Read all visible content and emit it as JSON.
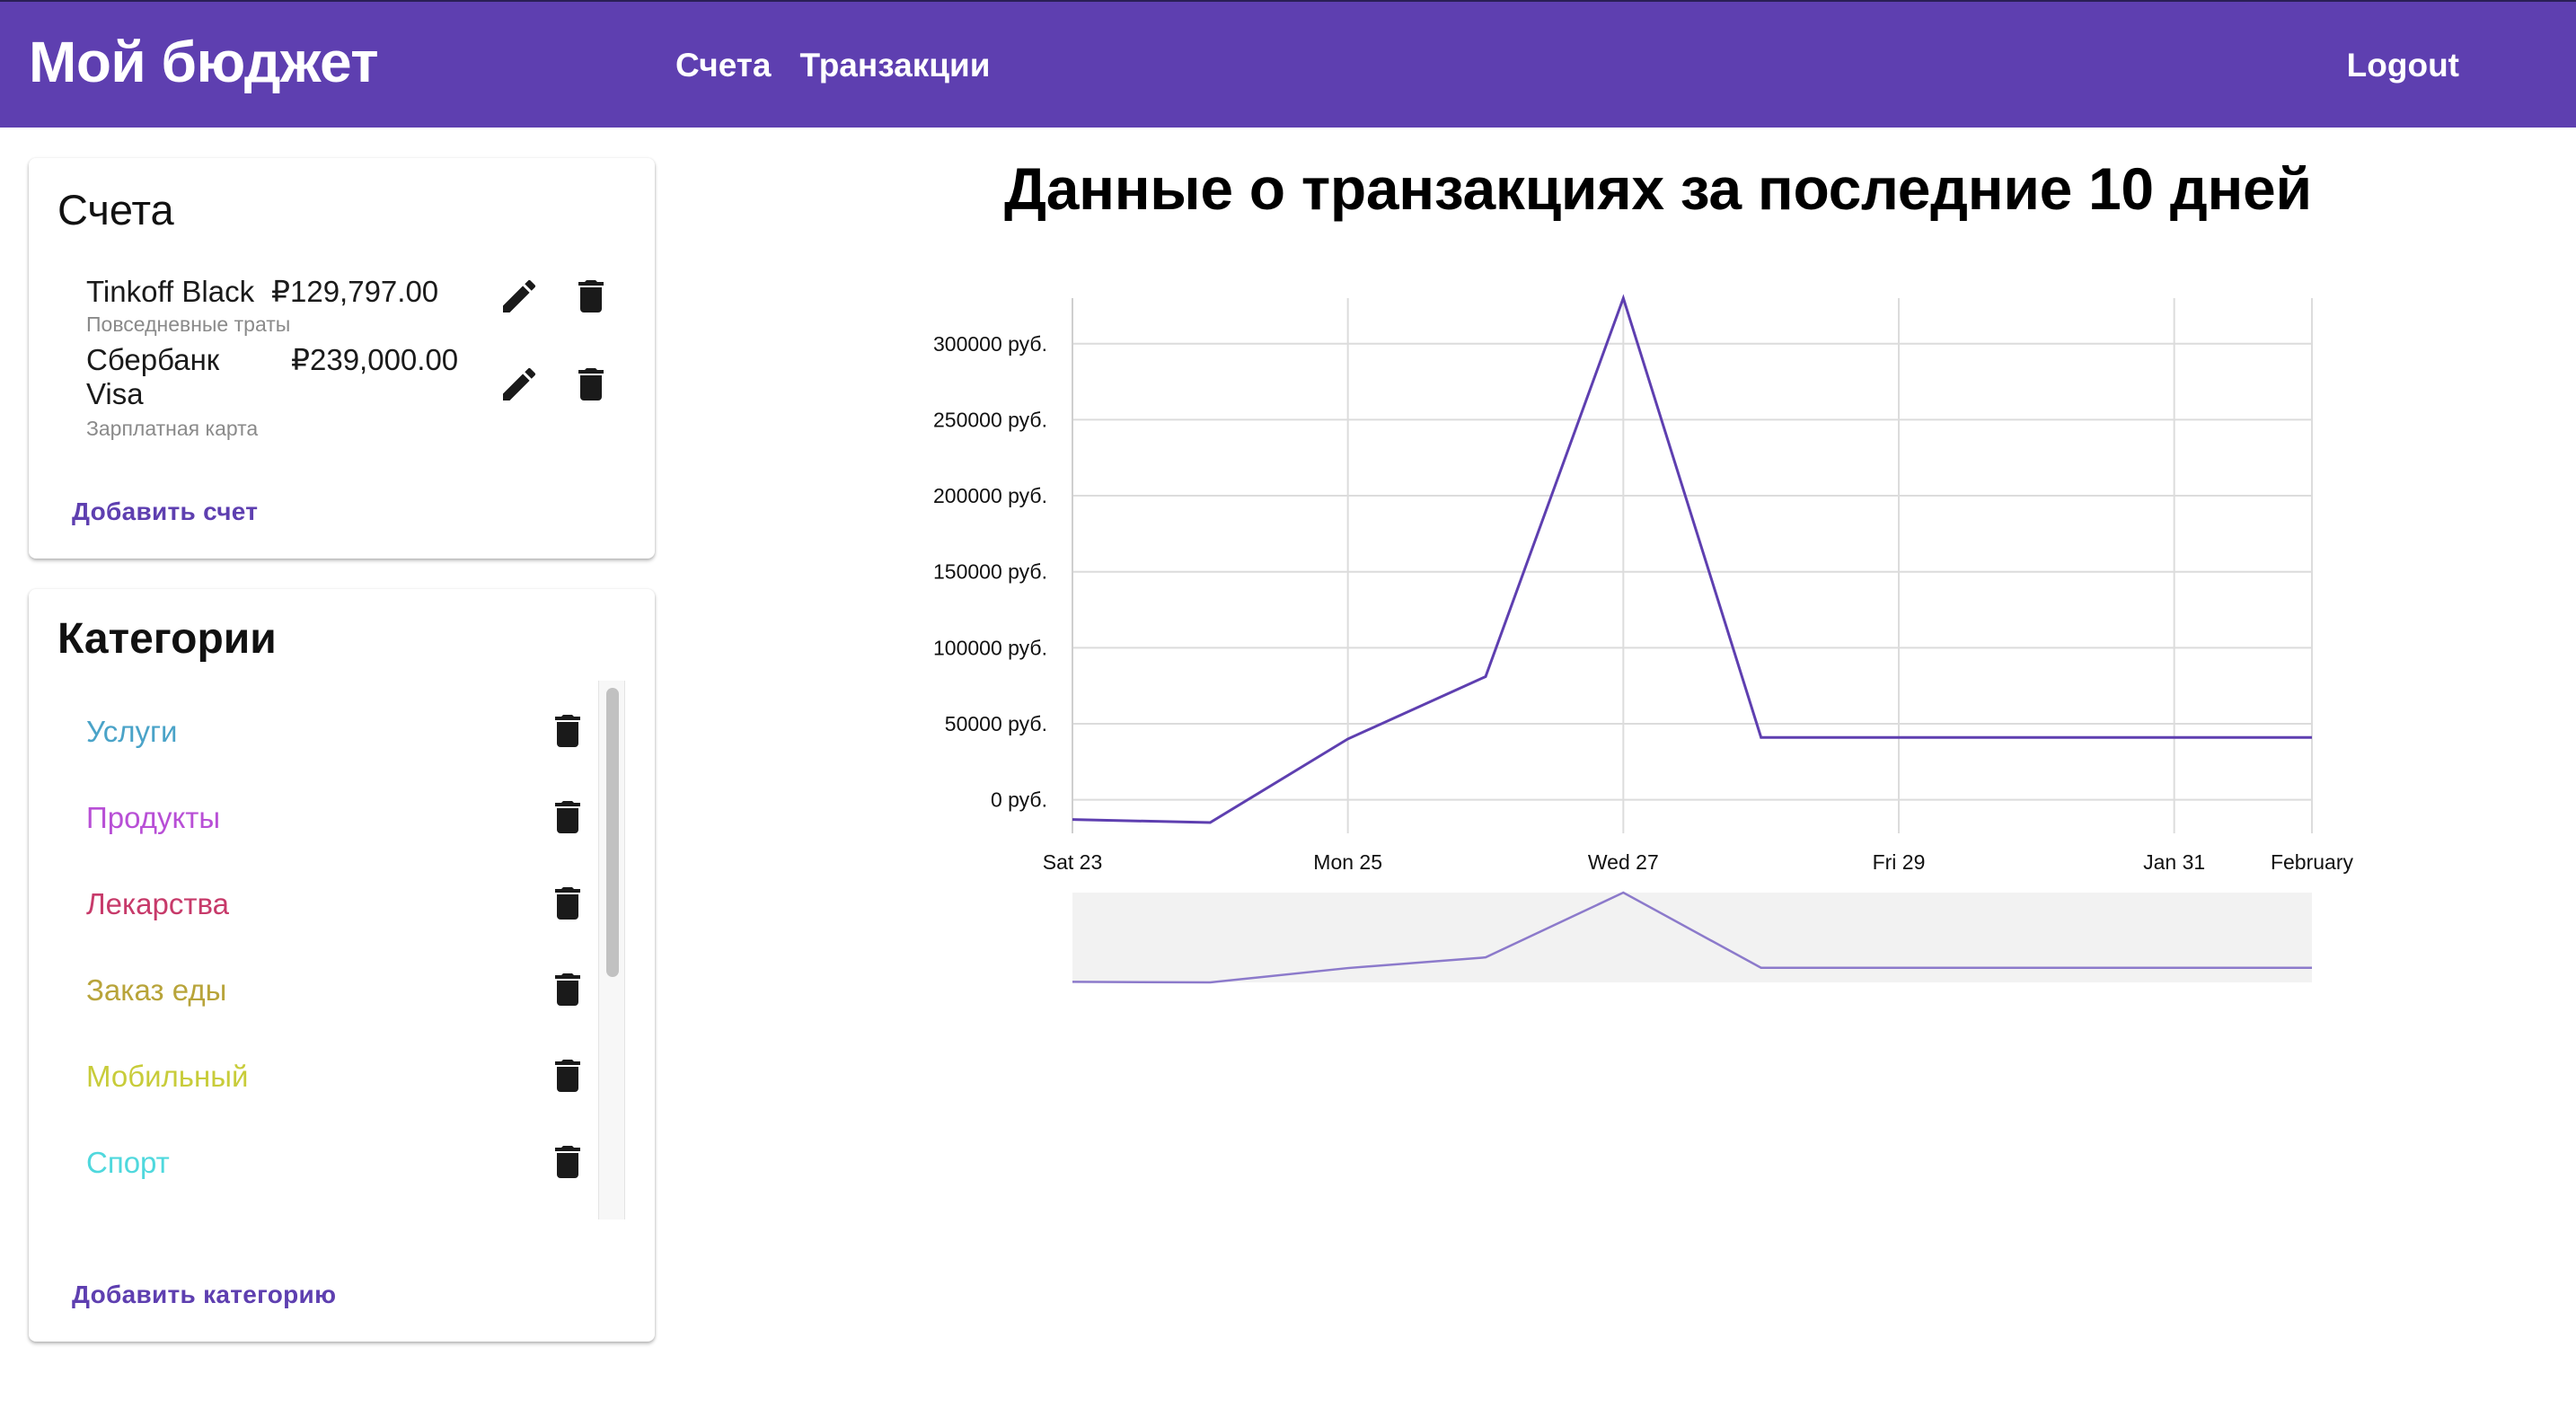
{
  "app": {
    "title": "Мой бюджет",
    "nav": [
      "Счета",
      "Транзакции"
    ],
    "logout": "Logout",
    "brand_color": "#5e3fb0"
  },
  "accounts_card": {
    "title": "Счета",
    "accounts": [
      {
        "name": "Tinkoff Black",
        "amount": "₽129,797.00",
        "description": "Повседневные траты"
      },
      {
        "name_line1": "Сбербанк",
        "name_line2": "Visa",
        "amount": "₽239,000.00",
        "description": "Зарплатная карта"
      }
    ],
    "icons": {
      "edit": "pencil-icon",
      "delete": "trash-icon"
    },
    "add_label": "Добавить счет"
  },
  "categories_card": {
    "title": "Категории",
    "items": [
      {
        "label": "Услуги",
        "color": "#4aa3c8"
      },
      {
        "label": "Продукты",
        "color": "#b84fd6"
      },
      {
        "label": "Лекарства",
        "color": "#c73a6a"
      },
      {
        "label": "Заказ еды",
        "color": "#b8a43a"
      },
      {
        "label": "Мобильный",
        "color": "#c8cc3a"
      },
      {
        "label": "Спорт",
        "color": "#4fd8dd"
      }
    ],
    "add_label": "Добавить категорию"
  },
  "chart_data": {
    "type": "line",
    "title": "Данные о транзакциях за последние 10 дней",
    "x": [
      "Jan 23",
      "Jan 24",
      "Jan 25",
      "Jan 26",
      "Jan 27",
      "Jan 28",
      "Jan 29",
      "Jan 30",
      "Jan 31",
      "Feb 1"
    ],
    "x_tick_labels": [
      "Sat 23",
      "Mon 25",
      "Wed 27",
      "Fri 29",
      "Jan 31",
      "February"
    ],
    "series": [
      {
        "values": [
          -13000,
          -15000,
          40000,
          81000,
          330000,
          41000,
          41000,
          41000,
          41000,
          41000
        ],
        "color": "#5e3fb0"
      }
    ],
    "y_tick_labels": [
      "0 руб.",
      "50000 руб.",
      "100000 руб.",
      "150000 руб.",
      "200000 руб.",
      "250000 руб.",
      "300000 руб."
    ],
    "ylim": [
      -15000,
      330000
    ],
    "grid": true,
    "navigator": true
  }
}
